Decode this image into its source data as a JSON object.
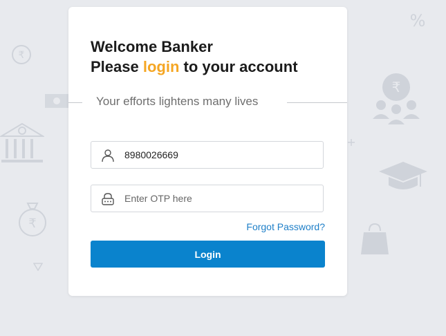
{
  "header": {
    "title_line1": "Welcome Banker",
    "title_line2_prefix": "Please ",
    "title_line2_accent": "login",
    "title_line2_suffix": " to your account"
  },
  "tagline": "Your efforts lightens many lives",
  "form": {
    "username_value": "8980026669",
    "otp_placeholder": "Enter OTP here",
    "forgot_label": "Forgot Password?",
    "login_label": "Login"
  },
  "icons": {
    "username": "user-icon",
    "otp": "lock-icon"
  },
  "colors": {
    "accent": "#f5a623",
    "primary_button": "#0a83cd",
    "link": "#1e7fc8",
    "background": "#e8eaee"
  }
}
